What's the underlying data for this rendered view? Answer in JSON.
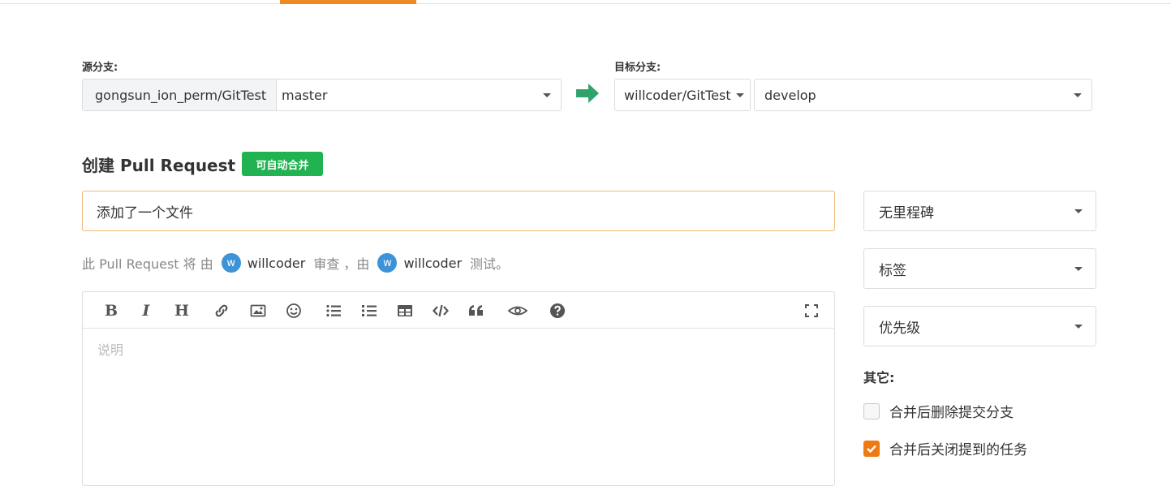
{
  "source": {
    "label": "源分支:",
    "repo": "gongsun_ion_perm/GitTest",
    "branch": "master"
  },
  "target": {
    "label": "目标分支:",
    "repo": "willcoder/GitTest",
    "branch": "develop"
  },
  "form": {
    "heading": "创建 Pull Request",
    "badge": "可自动合并",
    "title_value": "添加了一个文件",
    "review": {
      "prefix": "此 Pull Request 将 由",
      "reviewer_initial": "w",
      "reviewer": "willcoder",
      "mid": "审查 ，由",
      "tester_initial": "w",
      "tester": "willcoder",
      "suffix": "测试。"
    },
    "description_placeholder": "说明"
  },
  "toolbar": {
    "icons": [
      "bold-icon",
      "italic-icon",
      "heading-icon",
      "link-icon",
      "image-icon",
      "emoji-icon",
      "unordered-list-icon",
      "ordered-list-icon",
      "table-icon",
      "code-icon",
      "quote-icon",
      "preview-icon",
      "help-icon",
      "fullscreen-icon"
    ],
    "bold_glyph": "B",
    "italic_glyph": "I",
    "heading_glyph": "H"
  },
  "sidebar": {
    "milestone": "无里程碑",
    "labels": "标签",
    "priority": "优先级",
    "other_label": "其它:",
    "options": [
      {
        "label": "合并后删除提交分支",
        "checked": false
      },
      {
        "label": "合并后关闭提到的任务",
        "checked": true
      }
    ]
  },
  "colors": {
    "accent": "#f08a24",
    "success": "#21b351",
    "avatar": "#3d93d8",
    "checkbox_on": "#f07a12"
  }
}
